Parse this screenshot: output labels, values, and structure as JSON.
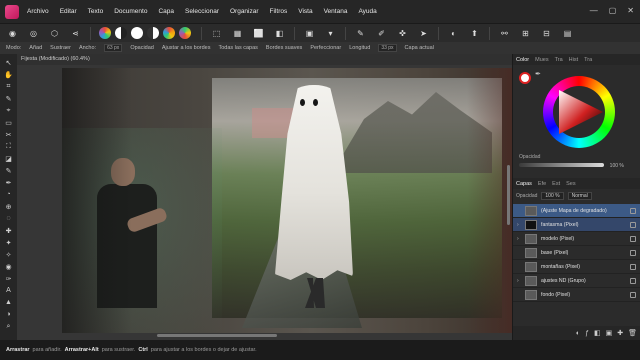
{
  "menubar": {
    "items": [
      "Archivo",
      "Editar",
      "Texto",
      "Documento",
      "Capa",
      "Seleccionar",
      "Organizar",
      "Filtros",
      "Vista",
      "Ventana",
      "Ayuda"
    ],
    "window_controls": [
      "minimize-icon",
      "maximize-icon",
      "close-icon"
    ]
  },
  "toolbar": {
    "personas": [
      "photo-persona-icon",
      "liquify-persona-icon",
      "develop-persona-icon",
      "share-icon"
    ],
    "color_dots": [
      "#e74c3c",
      "#f1c40f",
      "#3498db",
      "#2ecc71"
    ],
    "icons": [
      "color-wheel-icon",
      "half-circle-icon",
      "circle-icon",
      "contrast-icon",
      "crop-icon",
      "grid-icon",
      "mask-icon",
      "link-icon",
      "brush-icon",
      "pen-icon",
      "adjust-icon",
      "arrow-icon",
      "eye-icon",
      "cursor-icon",
      "ruler-icon"
    ]
  },
  "ctxbar": {
    "items": [
      {
        "label": "Modo:",
        "value": ""
      },
      {
        "label": "Añad",
        "value": ""
      },
      {
        "label": "Sustraer",
        "value": ""
      },
      {
        "label": "Ancho:",
        "value": "63 px"
      },
      {
        "label": "Opacidad",
        "value": ""
      },
      {
        "label": "Ajustar a los bordes",
        "value": ""
      },
      {
        "label": "Todas las capas",
        "value": ""
      },
      {
        "label": "Bordes suaves",
        "value": ""
      },
      {
        "label": "Perfeccionar",
        "value": ""
      },
      {
        "label": "Longitud",
        "value": "33 px"
      },
      {
        "label": "Capa actual",
        "value": ""
      }
    ]
  },
  "document": {
    "tab_label": "Fijesta (Modificado) (60.4%)"
  },
  "color_panel": {
    "tabs": [
      "Color",
      "Mues",
      "Tra",
      "Hist",
      "Tra"
    ],
    "opacity_label": "Opacidad",
    "opacity_value": "100 %"
  },
  "layers_panel": {
    "tabs": [
      "Capas",
      "Efe",
      "Est",
      "Ses"
    ],
    "opacity_label": "Opacidad",
    "opacity_value": "100 %",
    "blend_label": "Normal",
    "layers": [
      {
        "name": "(Ajuste Mapa de degradado)",
        "selected": true,
        "dark": false,
        "expand": ""
      },
      {
        "name": "fantasma (Pixel)",
        "selected": true,
        "dark": true,
        "expand": "›"
      },
      {
        "name": "modelo (Pixel)",
        "selected": false,
        "dark": false,
        "expand": "›"
      },
      {
        "name": "base (Pixel)",
        "selected": false,
        "dark": false,
        "expand": ""
      },
      {
        "name": "montañas (Pixel)",
        "selected": false,
        "dark": false,
        "expand": ""
      },
      {
        "name": "ajustes ND (Grupo)",
        "selected": false,
        "dark": false,
        "expand": "›"
      },
      {
        "name": "fondo (Pixel)",
        "selected": false,
        "dark": false,
        "expand": ""
      }
    ],
    "footer_icons": [
      "adjustment-icon",
      "fx-icon",
      "mask-icon",
      "group-icon",
      "add-layer-icon",
      "trash-icon"
    ]
  },
  "status": {
    "parts": [
      {
        "bold": true,
        "text": "Arrastrar"
      },
      {
        "bold": false,
        "text": "para añadir."
      },
      {
        "bold": true,
        "text": "Arrastrar+Alt"
      },
      {
        "bold": false,
        "text": "para sustraer."
      },
      {
        "bold": true,
        "text": "Ctrl"
      },
      {
        "bold": false,
        "text": "para ajustar a los bordes o dejar de ajustar."
      }
    ]
  }
}
